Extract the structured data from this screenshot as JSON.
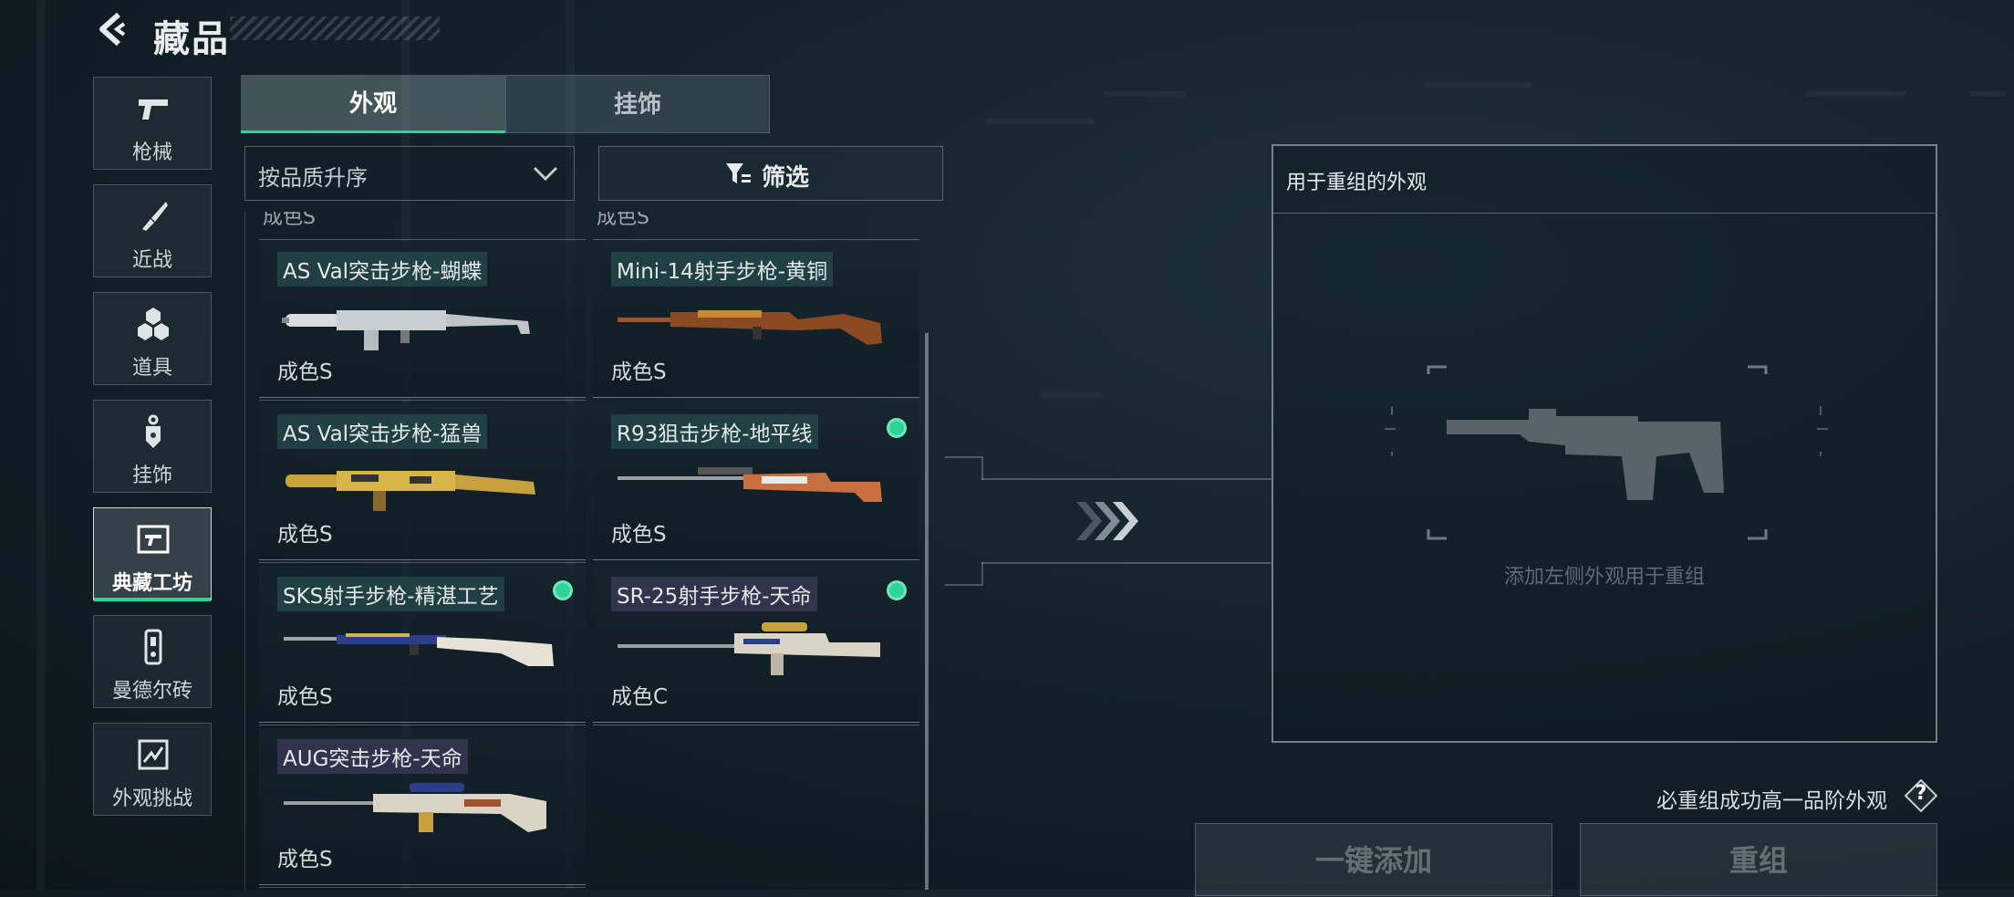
{
  "header": {
    "title": "藏品"
  },
  "nav": [
    {
      "label": "枪械",
      "icon": "pistol-icon",
      "active": false
    },
    {
      "label": "近战",
      "icon": "knife-icon",
      "active": false
    },
    {
      "label": "道具",
      "icon": "hexagon-cluster-icon",
      "active": false
    },
    {
      "label": "挂饰",
      "icon": "charm-tag-icon",
      "active": false
    },
    {
      "label": "典藏工坊",
      "icon": "workshop-frame-icon",
      "active": true
    },
    {
      "label": "曼德尔砖",
      "icon": "mandel-brick-icon",
      "active": false
    },
    {
      "label": "外观挑战",
      "icon": "challenge-icon",
      "active": false
    }
  ],
  "tabs": {
    "appearance": "外观",
    "pendant": "挂饰"
  },
  "sort": {
    "selected": "按品质升序"
  },
  "filter": {
    "label": "筛选"
  },
  "list": {
    "partial_top_left": "成色S",
    "partial_top_right": "成色S",
    "items": [
      {
        "name": "AS Val突击步枪-蝴蝶",
        "condition": "成色S",
        "selected": false,
        "tag_style": "green"
      },
      {
        "name": "Mini-14射手步枪-黄铜",
        "condition": "成色S",
        "selected": false,
        "tag_style": "green"
      },
      {
        "name": "AS Val突击步枪-猛兽",
        "condition": "成色S",
        "selected": false,
        "tag_style": "green"
      },
      {
        "name": "R93狙击步枪-地平线",
        "condition": "成色S",
        "selected": true,
        "tag_style": "green"
      },
      {
        "name": "SKS射手步枪-精湛工艺",
        "condition": "成色S",
        "selected": true,
        "tag_style": "green"
      },
      {
        "name": "SR-25射手步枪-天命",
        "condition": "成色C",
        "selected": true,
        "tag_style": "purple"
      },
      {
        "name": "AUG突击步枪-天命",
        "condition": "成色S",
        "selected": false,
        "tag_style": "purple"
      }
    ]
  },
  "panel": {
    "title": "用于重组的外观",
    "hint": "添加左侧外观用于重组"
  },
  "rule": {
    "text": "必重组成功高一品阶外观",
    "help": "?"
  },
  "buttons": {
    "add": "一键添加",
    "recombine": "重组"
  },
  "colors": {
    "accent": "#2fd39a",
    "panel_border": "#c8d2d7"
  }
}
